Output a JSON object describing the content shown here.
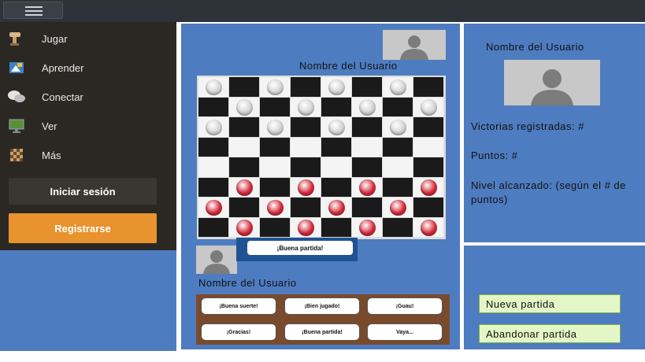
{
  "sidebar": {
    "items": [
      {
        "label": "Jugar",
        "icon": "pawn-icon"
      },
      {
        "label": "Aprender",
        "icon": "book-icon"
      },
      {
        "label": "Conectar",
        "icon": "chat-icon"
      },
      {
        "label": "Ver",
        "icon": "monitor-icon"
      },
      {
        "label": "Más",
        "icon": "board-icon"
      }
    ],
    "login_label": "Iniciar sesión",
    "register_label": "Registrarse"
  },
  "game": {
    "opponent_name": "Nombre del Usuario",
    "player_name": "Nombre del Usuario",
    "chat_bubble": "¡Buena partida!",
    "quick_messages": [
      "¡Buena suerte!",
      "¡Bien jugado!",
      "¡Guau!",
      "¡Gracias!",
      "¡Buena partida!",
      "Vaya..."
    ],
    "board": {
      "rows": 8,
      "cols": 8,
      "white_rows": [
        0,
        1,
        2
      ],
      "red_rows": [
        5,
        6,
        7
      ],
      "dark_square_color": "#1a1a1a",
      "light_square_color": "#f4f4f4",
      "white_piece_color": "#d4d4d4",
      "red_piece_color": "#d42a3a"
    }
  },
  "profile": {
    "name": "Nombre del Usuario",
    "wins": "Victorias registradas: #",
    "points": "Puntos: #",
    "level": "Nivel alcanzado: (según el # de puntos)"
  },
  "actions": {
    "new_game": "Nueva partida",
    "abandon": "Abandonar partida"
  },
  "colors": {
    "panel_blue": "#4e7cc0",
    "accent_orange": "#e8932e",
    "sidebar_dark": "#2b2824"
  }
}
